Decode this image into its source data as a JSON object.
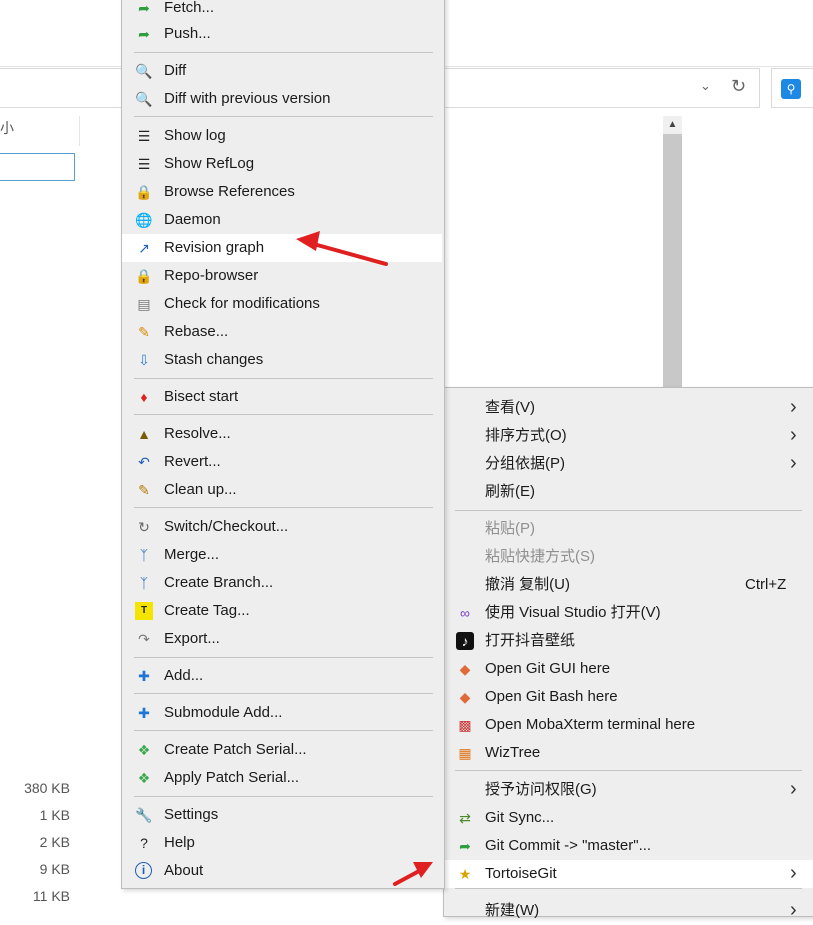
{
  "explorer": {
    "column_header": "大小",
    "sizes": [
      "380 KB",
      "1 KB",
      "2 KB",
      "9 KB",
      "11 KB"
    ]
  },
  "tortoise_menu": {
    "items": [
      {
        "label": "Fetch...",
        "icon": "fetch-icon"
      },
      {
        "label": "Push...",
        "icon": "push-icon"
      },
      {
        "label": "Diff",
        "icon": "diff-icon"
      },
      {
        "label": "Diff with previous version",
        "icon": "diff-icon"
      },
      {
        "label": "Show log",
        "icon": "log-icon"
      },
      {
        "label": "Show RefLog",
        "icon": "reflog-icon"
      },
      {
        "label": "Browse References",
        "icon": "references-icon"
      },
      {
        "label": "Daemon",
        "icon": "globe-icon"
      },
      {
        "label": "Revision graph",
        "icon": "revision-graph-icon",
        "highlighted": true
      },
      {
        "label": "Repo-browser",
        "icon": "repo-browser-icon"
      },
      {
        "label": "Check for modifications",
        "icon": "check-modifications-icon"
      },
      {
        "label": "Rebase...",
        "icon": "rebase-icon"
      },
      {
        "label": "Stash changes",
        "icon": "stash-icon"
      },
      {
        "label": "Bisect start",
        "icon": "bisect-icon"
      },
      {
        "label": "Resolve...",
        "icon": "resolve-icon"
      },
      {
        "label": "Revert...",
        "icon": "revert-icon"
      },
      {
        "label": "Clean up...",
        "icon": "broom-icon"
      },
      {
        "label": "Switch/Checkout...",
        "icon": "switch-icon"
      },
      {
        "label": "Merge...",
        "icon": "merge-icon"
      },
      {
        "label": "Create Branch...",
        "icon": "branch-icon"
      },
      {
        "label": "Create Tag...",
        "icon": "tag-icon"
      },
      {
        "label": "Export...",
        "icon": "export-icon"
      },
      {
        "label": "Add...",
        "icon": "plus-icon"
      },
      {
        "label": "Submodule Add...",
        "icon": "plus-icon"
      },
      {
        "label": "Create Patch Serial...",
        "icon": "patch-icon"
      },
      {
        "label": "Apply Patch Serial...",
        "icon": "patch-icon"
      },
      {
        "label": "Settings",
        "icon": "wrench-icon"
      },
      {
        "label": "Help",
        "icon": "help-icon"
      },
      {
        "label": "About",
        "icon": "info-icon"
      }
    ]
  },
  "context_menu": {
    "items": [
      {
        "label": "查看(V)",
        "submenu": true
      },
      {
        "label": "排序方式(O)",
        "submenu": true
      },
      {
        "label": "分组依据(P)",
        "submenu": true
      },
      {
        "label": "刷新(E)"
      },
      {
        "label": "粘贴(P)",
        "disabled": true
      },
      {
        "label": "粘贴快捷方式(S)",
        "disabled": true
      },
      {
        "label": "撤消 复制(U)",
        "shortcut": "Ctrl+Z"
      },
      {
        "label": "使用 Visual Studio 打开(V)",
        "icon": "visual-studio-icon"
      },
      {
        "label": "打开抖音壁纸",
        "icon": "douyin-icon"
      },
      {
        "label": "Open Git GUI here",
        "icon": "git-gui-icon"
      },
      {
        "label": "Open Git Bash here",
        "icon": "git-bash-icon"
      },
      {
        "label": "Open MobaXterm terminal here",
        "icon": "mobaxterm-icon"
      },
      {
        "label": "WizTree",
        "icon": "wiztree-icon"
      },
      {
        "label": "授予访问权限(G)",
        "submenu": true
      },
      {
        "label": "Git Sync...",
        "icon": "git-sync-icon"
      },
      {
        "label": "Git Commit -> \"master\"...",
        "icon": "git-commit-icon"
      },
      {
        "label": "TortoiseGit",
        "icon": "tortoisegit-icon",
        "submenu": true,
        "highlighted": true
      },
      {
        "label": "新建(W)",
        "submenu": true
      }
    ]
  },
  "colors": {
    "menu_bg": "#eeeeee",
    "highlight": "#ffffff",
    "annotation_arrow": "#e02020"
  }
}
